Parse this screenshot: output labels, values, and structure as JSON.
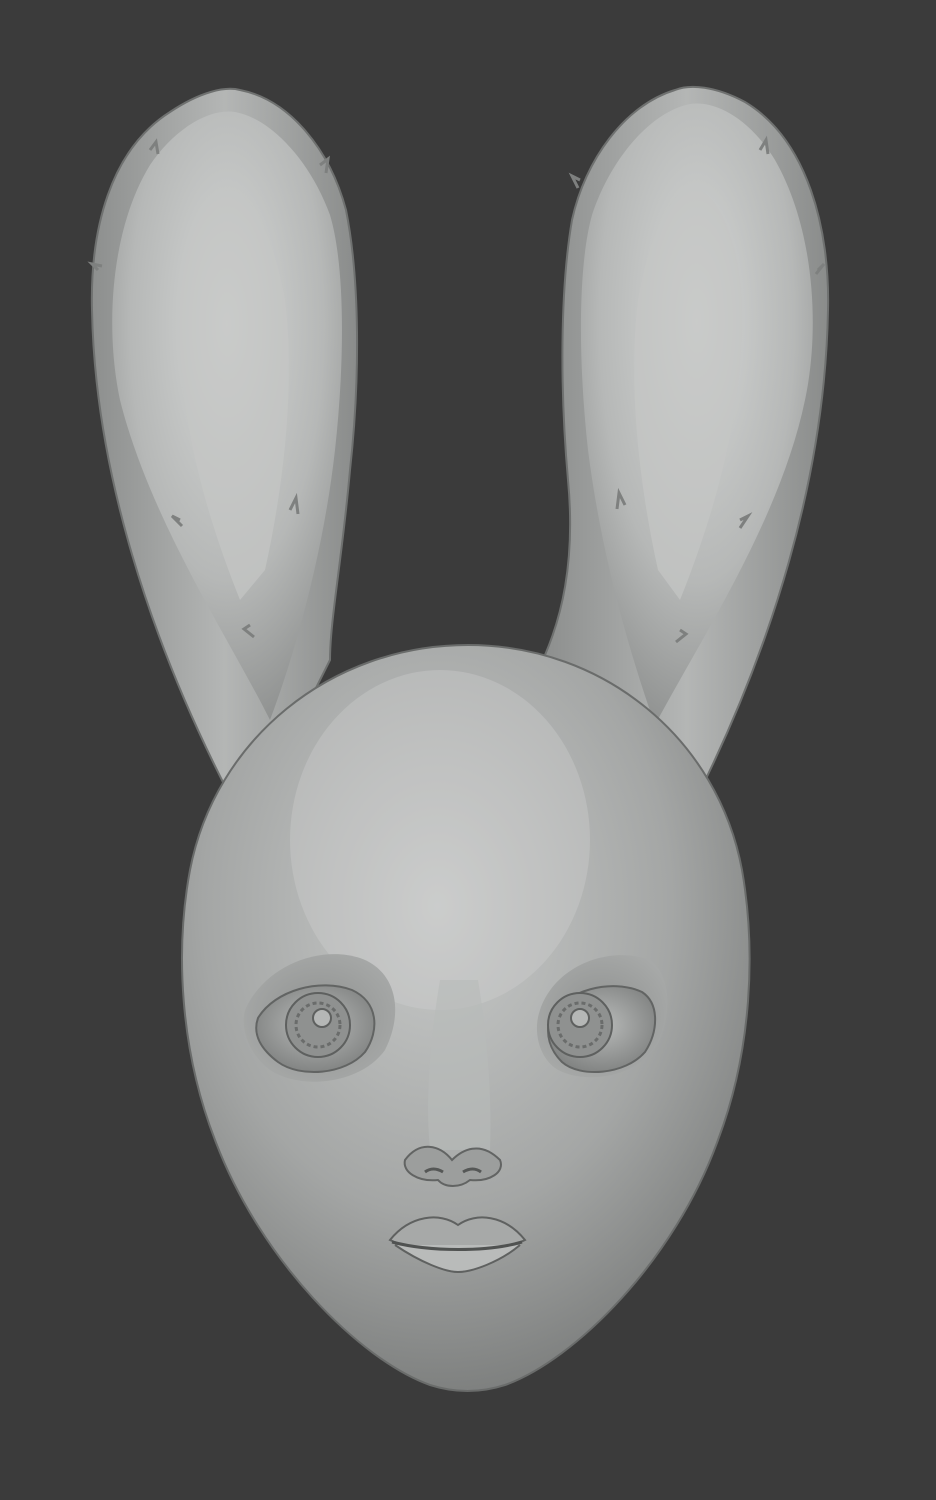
{
  "scene": {
    "background_color": "#3b3b3b",
    "clay_color": "#a9abaa",
    "subject": "rabbit-eared-doll-head-sculpt"
  },
  "icons": {
    "left_ear": "left-ear",
    "right_ear": "right-ear",
    "head": "head",
    "left_eye": "left-eye",
    "right_eye": "right-eye",
    "nose": "nose",
    "mouth": "mouth"
  }
}
